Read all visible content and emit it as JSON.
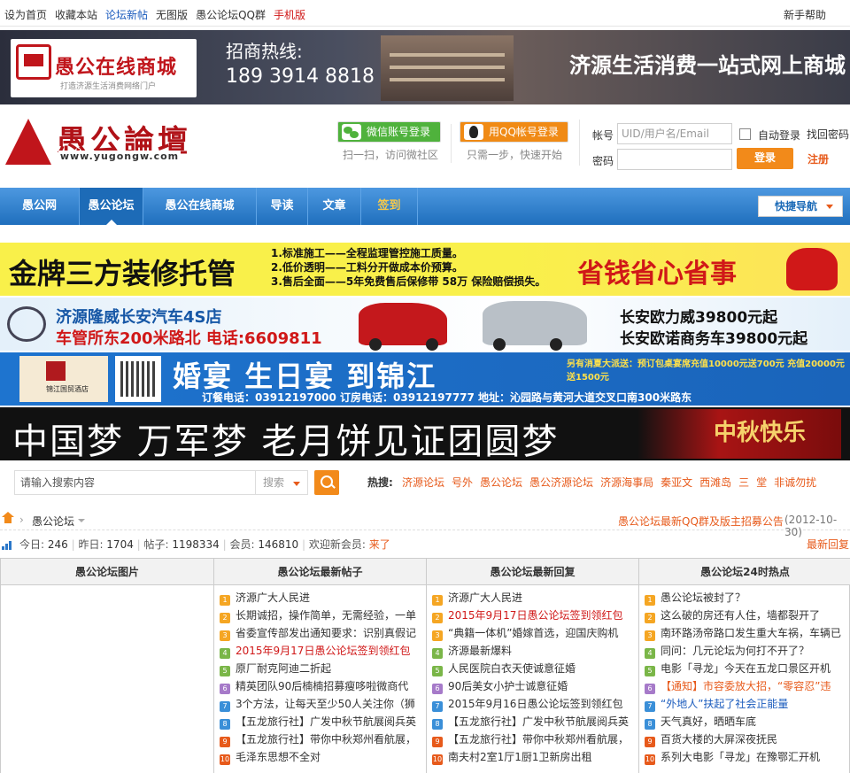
{
  "topbar": {
    "links": [
      {
        "label": "设为首页",
        "color": "#333"
      },
      {
        "label": "收藏本站",
        "color": "#333"
      },
      {
        "label": "论坛新帖",
        "color": "#1a5bbd"
      },
      {
        "label": "无图版",
        "color": "#333"
      },
      {
        "label": "愚公论坛QQ群",
        "color": "#333"
      },
      {
        "label": "手机版",
        "color": "#d01818"
      }
    ],
    "help": "新手帮助"
  },
  "shop_banner": {
    "logo_name": "愚公在线商城",
    "logo_sub": "打造济源生活消费网络门户",
    "hotline_label": "招商热线:",
    "phone": "189 3914 8818",
    "slogan": "济源生活消费一站式网上商城"
  },
  "header": {
    "logo_text": "愚公論壇",
    "logo_url": "www.yugongw.com",
    "wechat_login": "微信账号登录",
    "wechat_sub": "扫一扫，访问微社区",
    "qq_login": "用QQ帐号登录",
    "qq_sub": "只需一步，快速开始",
    "account_label": "帐号",
    "account_placeholder": "UID/用户名/Email",
    "password_label": "密码",
    "auto_login": "自动登录",
    "forgot": "找回密码",
    "login": "登录",
    "register": "注册"
  },
  "nav": {
    "items": [
      "愚公网",
      "愚公论坛",
      "愚公在线商城",
      "导读",
      "文章",
      "签到"
    ],
    "active": "愚公论坛",
    "quick": "快捷导航"
  },
  "ads": {
    "ad1": {
      "headline": "金牌三方装修托管",
      "points": [
        "1.标准施工——全程监理管控施工质量。",
        "2.低价透明——工料分开做成本价预算。",
        "3.售后全面——5年免费售后保修带 58万 保险赔偿损失。"
      ],
      "slogan": "省钱省心省事"
    },
    "ad2": {
      "line1": "济源隆威长安汽车4S店",
      "line2": "车管所东200米路北  电话:6609811",
      "right1": "长安欧力威39800元起",
      "right2": "长安欧诺商务车39800元起"
    },
    "ad3": {
      "hotel": "锦江国贸酒店",
      "headline": "婚宴  生日宴  到锦江",
      "tag": "另有消夏大派送：预订包桌宴席充值10000元送700元 充值20000元送1500元",
      "phones": "订餐电话：03912197000   订房电话：03912197777   地址：沁园路与黄河大道交叉口南300米路东"
    },
    "ad4": {
      "headline": "中国梦  万军梦  老月饼见证团圆梦",
      "slogan": "中秋快乐"
    }
  },
  "search": {
    "placeholder": "请输入搜索内容",
    "type": "搜索",
    "hot_label": "热搜:",
    "hot": [
      "济源论坛",
      "号外",
      "愚公论坛",
      "愚公济源论坛",
      "济源海事局",
      "秦亚文",
      "西滩岛",
      "三",
      "堂",
      "非诚勿扰"
    ]
  },
  "crumbs": {
    "forum": "愚公论坛",
    "announcement": "愚公论坛最新QQ群及版主招募公告",
    "announcement_date": "(2012-10-30)"
  },
  "stats": {
    "today_label": "今日: ",
    "today": "246",
    "yesterday_label": "昨日: ",
    "yesterday": "1704",
    "posts_label": "帖子: ",
    "posts": "1198334",
    "members_label": "会员: ",
    "members": "146810",
    "welcome": "欢迎新会员: ",
    "new_member": "来了",
    "latest_reply": "最新回复"
  },
  "grid": {
    "columns": [
      {
        "title": "愚公论坛图片",
        "items": []
      },
      {
        "title": "愚公论坛最新帖子",
        "items": [
          {
            "text": "济源广大人民进",
            "color": "#333"
          },
          {
            "text": "长期诚招，操作简单，无需经验，一单",
            "color": "#333"
          },
          {
            "text": "省委宣传部发出通知要求：识别真假记",
            "color": "#333"
          },
          {
            "text": "2015年9月17日愚公论坛签到领红包",
            "color": "#d01818"
          },
          {
            "text": "原厂耐克阿迪二折起",
            "color": "#333"
          },
          {
            "text": "精英团队90后楠楠招募瘦哆啦微商代",
            "color": "#333"
          },
          {
            "text": "3个方法，让每天至少50人关注你（狮",
            "color": "#333"
          },
          {
            "text": "【五龙旅行社】广发中秋节航展阅兵英",
            "color": "#333"
          },
          {
            "text": "【五龙旅行社】带你中秋郑州看航展，",
            "color": "#333"
          },
          {
            "text": "毛泽东思想不全对",
            "color": "#333"
          }
        ]
      },
      {
        "title": "愚公论坛最新回复",
        "items": [
          {
            "text": "济源广大人民进",
            "color": "#333"
          },
          {
            "text": "2015年9月17日愚公论坛签到领红包",
            "color": "#d01818"
          },
          {
            "text": "“典籍一体机”婚嫁首选，迎国庆购机",
            "color": "#333"
          },
          {
            "text": "济源最新爆料",
            "color": "#333"
          },
          {
            "text": "人民医院白衣天使诚意征婚",
            "color": "#333"
          },
          {
            "text": "90后美女小护士诚意征婚",
            "color": "#333"
          },
          {
            "text": "2015年9月16日愚公论坛签到领红包",
            "color": "#333"
          },
          {
            "text": "【五龙旅行社】广发中秋节航展阅兵英",
            "color": "#333"
          },
          {
            "text": "【五龙旅行社】带你中秋郑州看航展，",
            "color": "#333"
          },
          {
            "text": "南夫村2室1厅1厨1卫新房出租",
            "color": "#333"
          }
        ]
      },
      {
        "title": "愚公论坛24时热点",
        "items": [
          {
            "text": "愚公论坛被封了？",
            "color": "#333"
          },
          {
            "text": "这么破的房还有人住，墙都裂开了",
            "color": "#333"
          },
          {
            "text": "南环路汤帝路口发生重大车祸，车辆已",
            "color": "#333"
          },
          {
            "text": "同问：几元论坛为何打不开了？",
            "color": "#333"
          },
          {
            "text": "电影「寻龙」今天在五龙口景区开机",
            "color": "#333"
          },
          {
            "text": "【通知】市容委放大招，“零容忍”违",
            "color": "#e75a1b"
          },
          {
            "text": "“外地人”扶起了社会正能量",
            "color": "#1a5bbd"
          },
          {
            "text": "天气真好，晒晒车底",
            "color": "#333"
          },
          {
            "text": "百货大楼的大屏深夜抚民",
            "color": "#333"
          },
          {
            "text": "系列大电影「寻龙」在豫鄂汇开机",
            "color": "#333"
          }
        ]
      }
    ],
    "rank_colors": [
      "#f5a623",
      "#f5a623",
      "#f5a623",
      "#7ab648",
      "#7ab648",
      "#a67ac9",
      "#3a8fd8",
      "#3a8fd8",
      "#e75a1b",
      "#e75a1b"
    ]
  }
}
